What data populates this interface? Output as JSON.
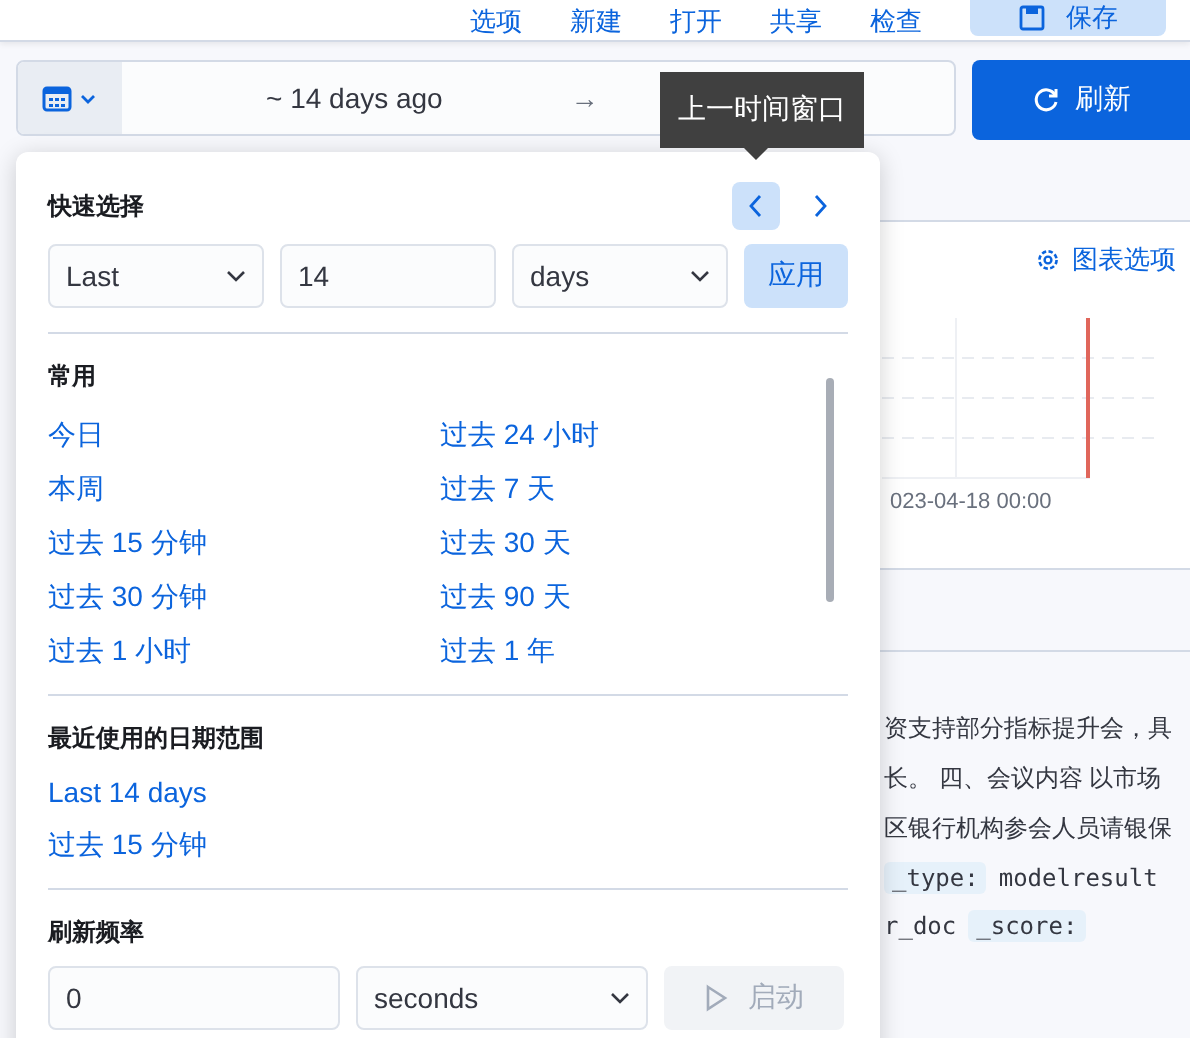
{
  "top_nav": {
    "links": [
      "选项",
      "新建",
      "打开",
      "共享",
      "检查"
    ],
    "save_button": "保存"
  },
  "date_picker": {
    "start": "~ 14 days ago",
    "arrow": "→"
  },
  "refresh_button": "刷新",
  "tooltip": "上一时间窗口",
  "background": {
    "chart_options": "图表选项",
    "axis_label": "023-04-18 00:00",
    "text_lines": [
      "资支持部分指标提升会，具",
      "长。 四、会议内容 以市场",
      "区银行机构参会人员请银保"
    ],
    "field_rows": [
      [
        {
          "kind": "tag",
          "text": "_type:"
        },
        {
          "kind": "code",
          "text": "modelresult"
        }
      ],
      [
        {
          "kind": "code",
          "text": "r_doc"
        },
        {
          "kind": "tag",
          "text": "_score:"
        }
      ]
    ]
  },
  "quick_select": {
    "title": "快速选择",
    "prev_hovered": true,
    "next_hovered": false,
    "direction": "Last",
    "value": "14",
    "unit": "days",
    "apply_button": "应用"
  },
  "commonly_used": {
    "title": "常用",
    "items": [
      "今日",
      "过去 24 小时",
      "本周",
      "过去 7 天",
      "过去 15 分钟",
      "过去 30 天",
      "过去 30 分钟",
      "过去 90 天",
      "过去 1 小时",
      "过去 1 年"
    ]
  },
  "recently_used": {
    "title": "最近使用的日期范围",
    "items": [
      "Last 14 days",
      "过去 15 分钟"
    ]
  },
  "refresh_interval": {
    "title": "刷新频率",
    "value": "0",
    "unit": "seconds",
    "start_button": {
      "label": "启动",
      "disabled": true
    }
  }
}
